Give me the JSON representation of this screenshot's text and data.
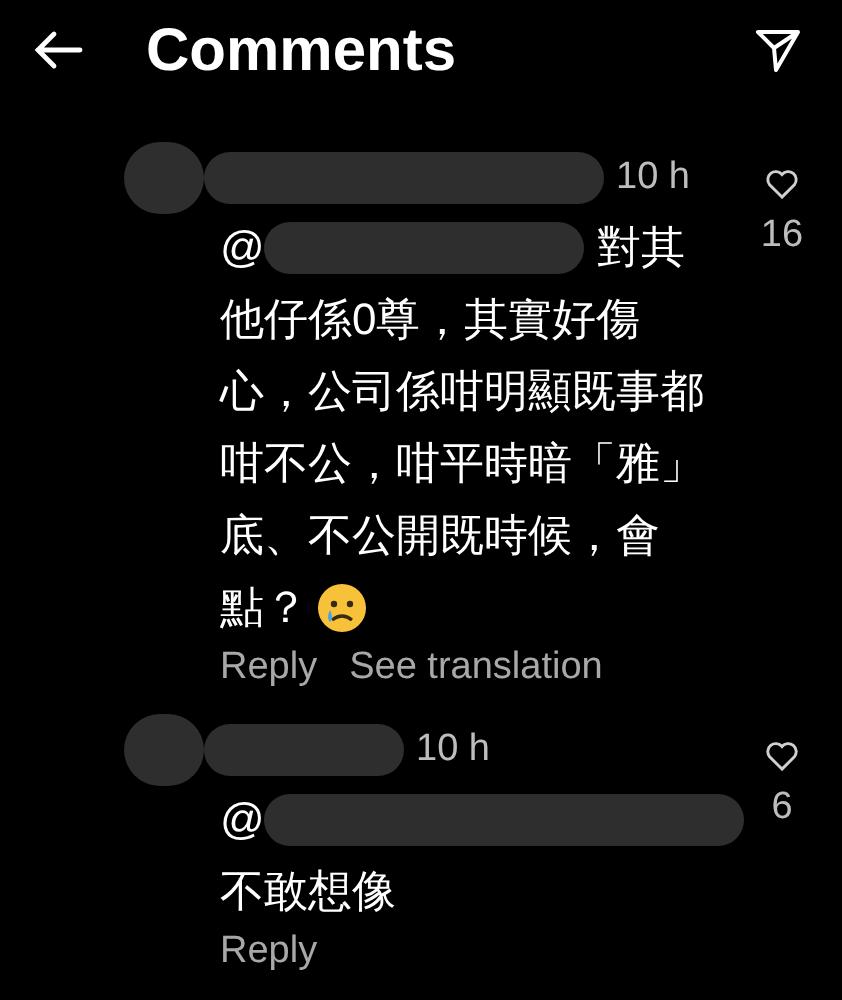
{
  "header": {
    "title": "Comments"
  },
  "comments": [
    {
      "time": "10 h",
      "likes": "16",
      "mention": "@",
      "first_line_end": "對其",
      "lines": [
        "他仔係0尊，其實好傷",
        "心，公司係咁明顯既事都",
        "咁不公，咁平時暗「雅」",
        "底、不公開既時候，會",
        "點？"
      ],
      "has_emoji": true,
      "actions": [
        "Reply",
        "See translation"
      ]
    },
    {
      "time": "10 h",
      "likes": "6",
      "mention": "@",
      "lines": [
        "不敢想像"
      ],
      "has_emoji": false,
      "actions": [
        "Reply"
      ]
    }
  ]
}
